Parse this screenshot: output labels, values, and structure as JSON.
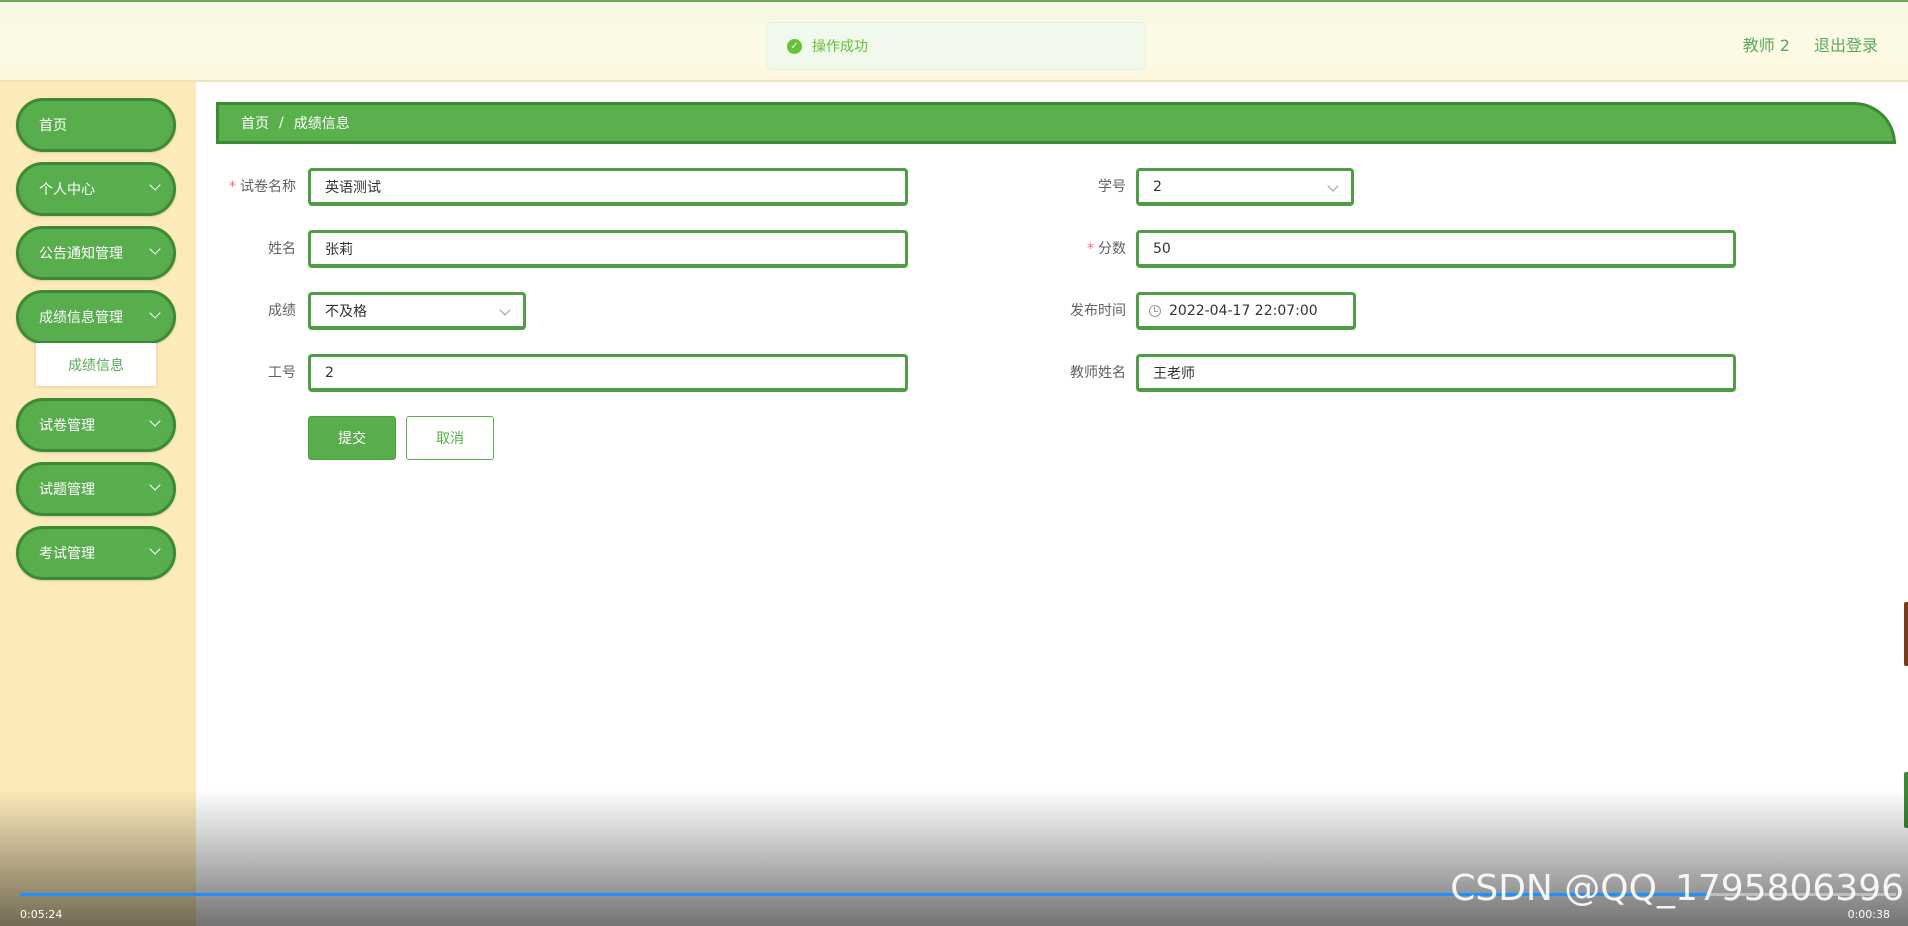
{
  "toast": {
    "message": "操作成功"
  },
  "header": {
    "user": "教师 2",
    "logout": "退出登录"
  },
  "sidebar": {
    "items": [
      {
        "label": "首页"
      },
      {
        "label": "个人中心"
      },
      {
        "label": "公告通知管理"
      },
      {
        "label": "成绩信息管理"
      },
      {
        "label": "试卷管理"
      },
      {
        "label": "试题管理"
      },
      {
        "label": "考试管理"
      }
    ],
    "submenu": {
      "label": "成绩信息"
    }
  },
  "breadcrumb": {
    "home": "首页",
    "separator": "/",
    "current": "成绩信息"
  },
  "form": {
    "paper_name": {
      "label": "试卷名称",
      "value": "英语测试"
    },
    "student_id": {
      "label": "学号",
      "value": "2"
    },
    "name": {
      "label": "姓名",
      "value": "张莉"
    },
    "score": {
      "label": "分数",
      "value": "50"
    },
    "grade": {
      "label": "成绩",
      "value": "不及格"
    },
    "publish_time": {
      "label": "发布时间",
      "value": "2022-04-17 22:07:00"
    },
    "staff_id": {
      "label": "工号",
      "value": "2"
    },
    "teacher_name": {
      "label": "教师姓名",
      "value": "王老师"
    },
    "submit": "提交",
    "cancel": "取消"
  },
  "video": {
    "elapsed": "0:05:24",
    "remaining": "0:00:38",
    "progress": 0.9
  },
  "watermark": "CSDN @QQ_1795806396",
  "colors": {
    "accent": "#58ad4d",
    "accent_dark": "#3d8a35",
    "sidebar_bg": "#fdeabb"
  }
}
